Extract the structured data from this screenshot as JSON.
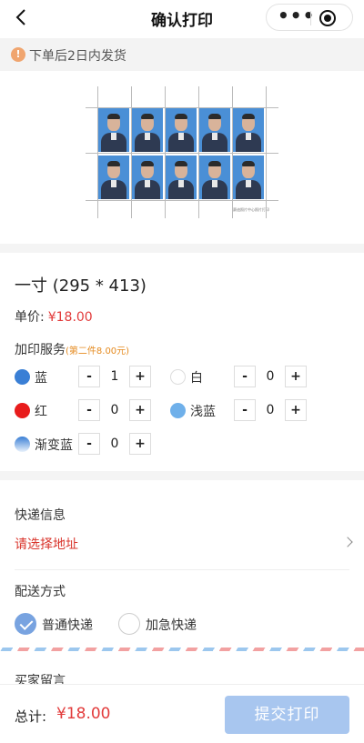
{
  "nav": {
    "title": "确认打印",
    "back_icon": "chevron-left-icon",
    "more_icon": "ellipsis-icon",
    "close_icon": "target-circle-icon"
  },
  "notice": {
    "text": "下单后2日内发货",
    "icon": "info-icon",
    "icon_color": "#f0a56f"
  },
  "preview": {
    "watermark": "赛迪照片中心照片打印",
    "rows": 2,
    "cols": 5,
    "background_color": "#4a8fd6"
  },
  "product": {
    "spec": "一寸 (295 * 413)",
    "price_label": "单价:",
    "price_value": "¥18.00"
  },
  "services": {
    "label": "加印服务",
    "promo": "(第二件8.00元)",
    "options": [
      {
        "name": "蓝",
        "qty": "1",
        "color": "#3a7fd5"
      },
      {
        "name": "白",
        "qty": "0",
        "color": "#ffffff"
      },
      {
        "name": "红",
        "qty": "0",
        "color": "#e81c1c"
      },
      {
        "name": "浅蓝",
        "qty": "0",
        "color": "#6fb0ea"
      },
      {
        "name": "渐变蓝",
        "qty": "0",
        "color": "gradient-blue"
      }
    ],
    "minus": "-",
    "plus": "+"
  },
  "shipping": {
    "label": "快递信息",
    "address_placeholder": "请选择地址",
    "address_chevron": "chevron-right-icon"
  },
  "delivery": {
    "label": "配送方式",
    "options": [
      {
        "label": "普通快递",
        "checked": true
      },
      {
        "label": "加急快递",
        "checked": false
      }
    ]
  },
  "message": {
    "label": "买家留言"
  },
  "footer": {
    "total_label": "总计:",
    "total_value": "¥18.00",
    "submit_label": "提交打印",
    "submit_color": "#a8c6ef"
  },
  "colors": {
    "price": "#e23b3b",
    "accent": "#78a3e0",
    "promo": "#e58a1f"
  }
}
